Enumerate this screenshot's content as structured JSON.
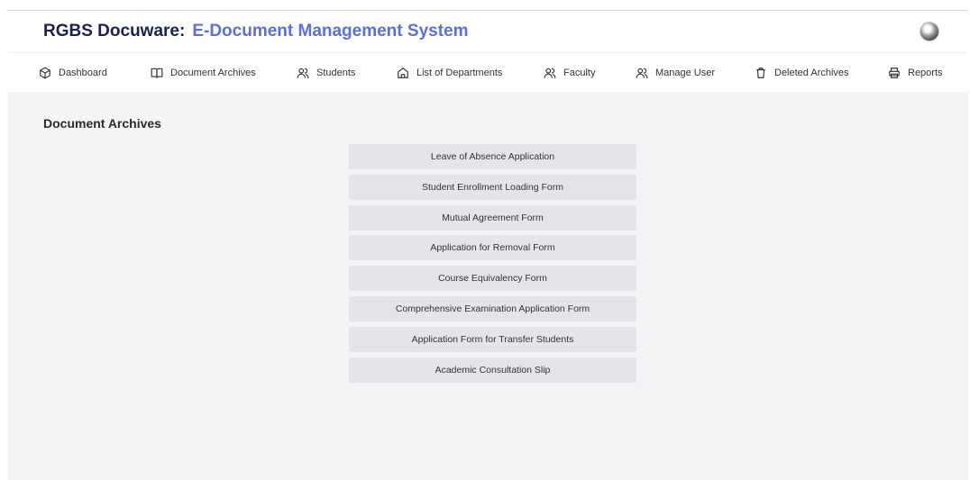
{
  "header": {
    "brand": "RGBS Docuware:",
    "subtitle": "E-Document Management System",
    "brand_color": "#1a1f55",
    "subtitle_color": "#5b6de6"
  },
  "nav": {
    "items": [
      {
        "label": "Dashboard",
        "icon": "box-icon"
      },
      {
        "label": "Document Archives",
        "icon": "book-open-icon"
      },
      {
        "label": "Students",
        "icon": "users-icon"
      },
      {
        "label": "List of Departments",
        "icon": "home-icon"
      },
      {
        "label": "Faculty",
        "icon": "users-icon"
      },
      {
        "label": "Manage User",
        "icon": "users-icon"
      },
      {
        "label": "Deleted Archives",
        "icon": "trash-icon"
      },
      {
        "label": "Reports",
        "icon": "printer-icon"
      }
    ]
  },
  "main": {
    "title": "Document Archives",
    "documents": [
      "Leave of Absence Application",
      "Student Enrollment Loading Form",
      "Mutual Agreement Form",
      "Application for Removal Form",
      "Course Equivalency Form",
      "Comprehensive Examination Application Form",
      "Application Form for Transfer Students",
      "Academic Consultation Slip"
    ]
  }
}
